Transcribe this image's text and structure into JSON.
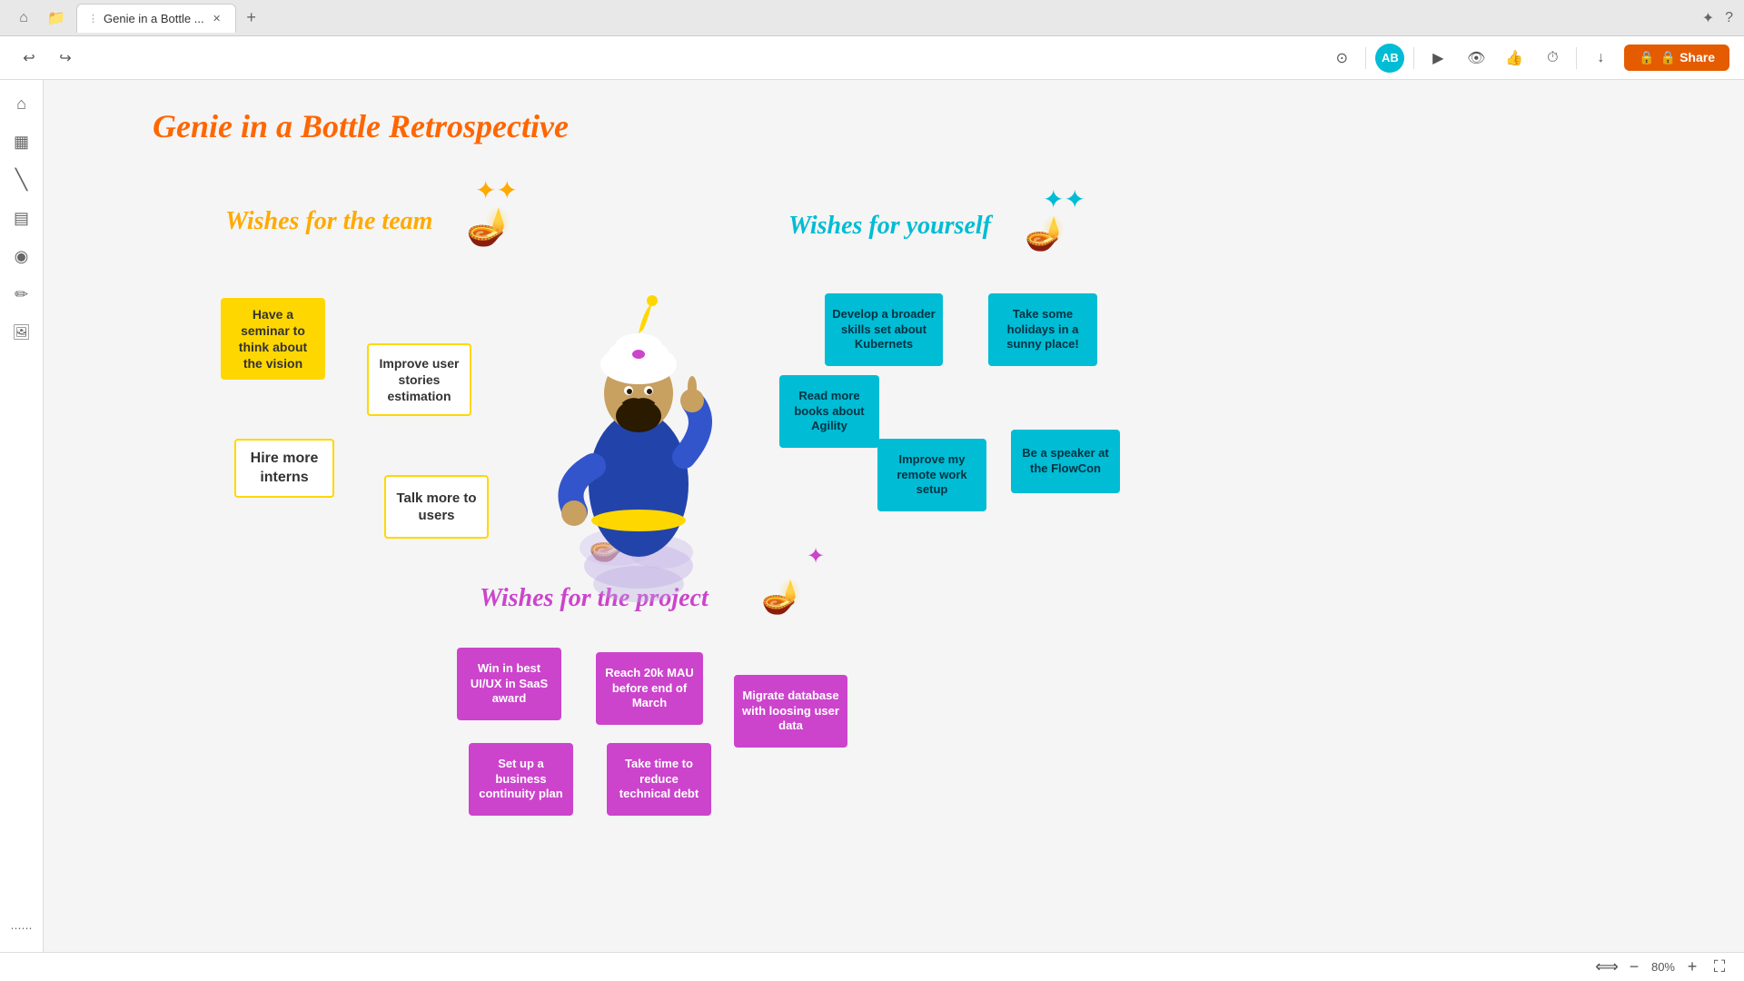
{
  "browser": {
    "tab_label": "Genie in a Bottle ...",
    "nav_back": "←",
    "nav_forward": "→",
    "actions": {
      "bookmark": "☆",
      "help": "?"
    }
  },
  "toolbar": {
    "avatar_initials": "AB",
    "share_label": "🔒 Share",
    "icons": {
      "capture": "⊙",
      "play": "▶",
      "view": "👁",
      "thumbs_up": "👍",
      "timer": "⏱",
      "download": "↓"
    }
  },
  "sidebar": {
    "icons": [
      {
        "name": "home",
        "symbol": "⌂"
      },
      {
        "name": "grid",
        "symbol": "▦"
      },
      {
        "name": "line",
        "symbol": "╱"
      },
      {
        "name": "table",
        "symbol": "▤"
      },
      {
        "name": "shapes",
        "symbol": "◉"
      },
      {
        "name": "pen",
        "symbol": "✏"
      },
      {
        "name": "image",
        "symbol": "🖼"
      },
      {
        "name": "apps",
        "symbol": "⋯"
      }
    ]
  },
  "canvas": {
    "title": "Genie in a Bottle Retrospective",
    "sections": {
      "team": "Wishes for the team",
      "yourself": "Wishes for yourself",
      "project": "Wishes for the project"
    },
    "team_notes": [
      {
        "id": "t1",
        "text": "Have a seminar to think about the vision",
        "style": "yellow"
      },
      {
        "id": "t2",
        "text": "Improve user stories estimation",
        "style": "yellow-outline"
      },
      {
        "id": "t3",
        "text": "Hire more interns",
        "style": "yellow-outline"
      },
      {
        "id": "t4",
        "text": "Talk more to users",
        "style": "yellow-outline"
      }
    ],
    "yourself_notes": [
      {
        "id": "y1",
        "text": "Develop a broader skills set about Kubernets",
        "style": "cyan"
      },
      {
        "id": "y2",
        "text": "Take some holidays in a sunny place!",
        "style": "cyan"
      },
      {
        "id": "y3",
        "text": "Read more books about Agility",
        "style": "cyan"
      },
      {
        "id": "y4",
        "text": "Improve my remote work setup",
        "style": "cyan"
      },
      {
        "id": "y5",
        "text": "Be a speaker at the FlowCon",
        "style": "cyan"
      }
    ],
    "project_notes": [
      {
        "id": "p1",
        "text": "Win in best UI/UX in SaaS award",
        "style": "purple"
      },
      {
        "id": "p2",
        "text": "Reach 20k MAU before end of March",
        "style": "purple"
      },
      {
        "id": "p3",
        "text": "Migrate database with loosing user data",
        "style": "purple"
      },
      {
        "id": "p4",
        "text": "Set up a business continuity plan",
        "style": "purple"
      },
      {
        "id": "p5",
        "text": "Take time to reduce technical debt",
        "style": "purple"
      }
    ]
  },
  "bottom_bar": {
    "zoom_level": "80%",
    "zoom_in": "+",
    "zoom_out": "−",
    "fit_icon": "⟺"
  }
}
